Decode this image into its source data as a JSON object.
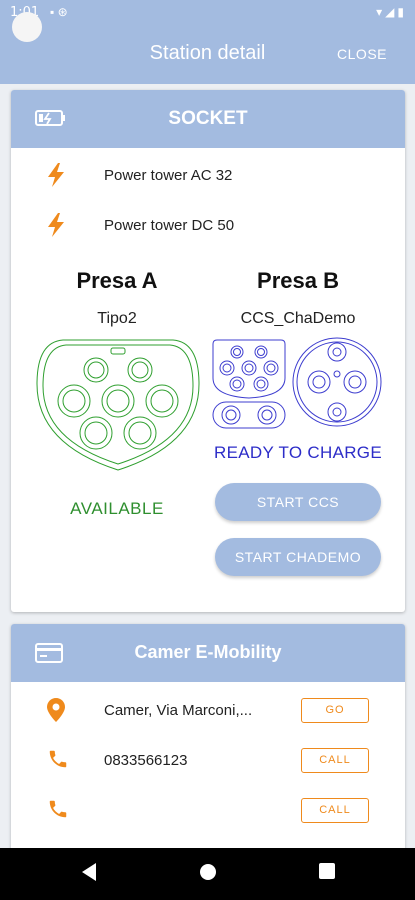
{
  "status_bar": {
    "time": "1:01",
    "left_icons": "▪ ⊛",
    "right_icons": "▾◢▮"
  },
  "app_bar": {
    "title": "Station detail",
    "close_label": "CLOSE"
  },
  "socket_card": {
    "header": "SOCKET",
    "power_rows": [
      {
        "label": "Power tower AC 32"
      },
      {
        "label": "Power tower DC 50"
      }
    ],
    "presa_a": {
      "title": "Presa A",
      "type": "Tipo2",
      "status": "AVAILABLE"
    },
    "presa_b": {
      "title": "Presa B",
      "type": "CCS_ChaDemo",
      "status": "READY TO CHARGE"
    },
    "buttons": {
      "start_ccs": "START CCS",
      "start_chademo": "START CHADEMO"
    }
  },
  "operator_card": {
    "header": "Camer E-Mobility",
    "rows": [
      {
        "icon": "location-pin-icon",
        "text": "Camer, Via Marconi,...",
        "action": "GO"
      },
      {
        "icon": "phone-icon",
        "text": "0833566123",
        "action": "CALL"
      },
      {
        "icon": "phone-icon",
        "text": "",
        "action": "CALL"
      }
    ]
  },
  "colors": {
    "primary": "#a3bbe0",
    "accent_orange": "#ef8a1c",
    "available_green": "#2f8f2f",
    "ready_blue": "#2d2dc8"
  }
}
